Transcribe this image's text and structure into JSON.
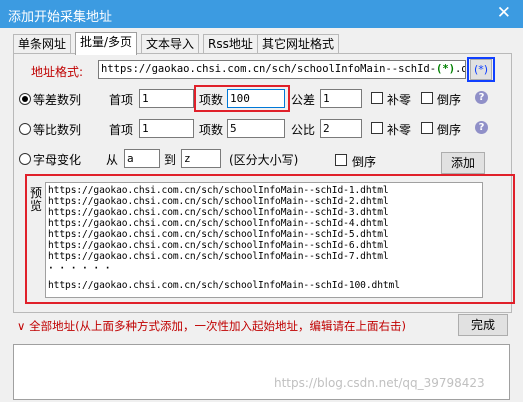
{
  "window": {
    "title": "添加开始采集地址",
    "close_glyph": "✕"
  },
  "tabs": [
    {
      "label": "单条网址"
    },
    {
      "label": "批量/多页"
    },
    {
      "label": "文本导入"
    },
    {
      "label": "Rss地址"
    },
    {
      "label": "其它网址格式"
    }
  ],
  "url_format": {
    "label": "地址格式:",
    "prefix": "https://gaokao.chsi.com.cn/sch/schoolInfoMain--schId-",
    "wildcard": "(*)",
    "suffix": ".dhtml",
    "insert_button": "(*)"
  },
  "arith": {
    "label": "等差数列",
    "first_label": "首项",
    "first_value": "1",
    "count_label": "项数",
    "count_value": "100",
    "diff_label": "公差",
    "diff_value": "1",
    "pad_label": "补零",
    "reverse_label": "倒序",
    "help": "?"
  },
  "geo": {
    "label": "等比数列",
    "first_label": "首项",
    "first_value": "1",
    "count_label": "项数",
    "count_value": "5",
    "ratio_label": "公比",
    "ratio_value": "2",
    "pad_label": "补零",
    "reverse_label": "倒序",
    "help": "?"
  },
  "letters": {
    "label": "字母变化",
    "from_label": "从",
    "from_value": "a",
    "to_label": "到",
    "to_value": "z",
    "case_label": "(区分大小写)",
    "reverse_label": "倒序",
    "add_button": "添加"
  },
  "preview": {
    "label_line1": "预",
    "label_line2": "览",
    "lines": [
      "https://gaokao.chsi.com.cn/sch/schoolInfoMain--schId-1.dhtml",
      "https://gaokao.chsi.com.cn/sch/schoolInfoMain--schId-2.dhtml",
      "https://gaokao.chsi.com.cn/sch/schoolInfoMain--schId-3.dhtml",
      "https://gaokao.chsi.com.cn/sch/schoolInfoMain--schId-4.dhtml",
      "https://gaokao.chsi.com.cn/sch/schoolInfoMain--schId-5.dhtml",
      "https://gaokao.chsi.com.cn/sch/schoolInfoMain--schId-6.dhtml",
      "https://gaokao.chsi.com.cn/sch/schoolInfoMain--schId-7.dhtml",
      "· · · · · ·",
      "https://gaokao.chsi.com.cn/sch/schoolInfoMain--schId-100.dhtml"
    ]
  },
  "footer": {
    "all_label": "∨ 全部地址(从上面多种方式添加，一次性加入起始地址，编辑请在上面右击)",
    "done_button": "完成",
    "watermark": "https://blog.csdn.net/qq_39798423"
  }
}
